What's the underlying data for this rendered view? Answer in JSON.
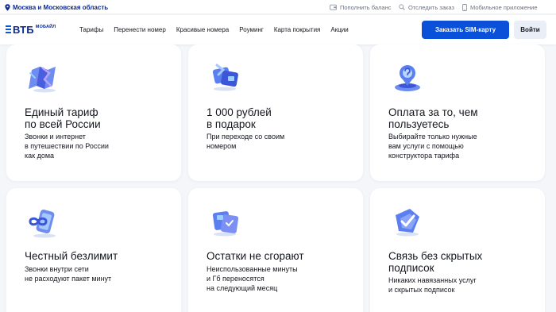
{
  "topbar": {
    "region": "Москва и Московская область",
    "links": [
      {
        "label": "Пополнить баланс",
        "icon": "wallet-icon"
      },
      {
        "label": "Отследить заказ",
        "icon": "search-icon"
      },
      {
        "label": "Мобильное приложение",
        "icon": "smartphone-icon"
      }
    ]
  },
  "header": {
    "logo": {
      "text": "ВТБ",
      "sub": "МОБАЙЛ"
    },
    "nav": [
      "Тарифы",
      "Перенести номер",
      "Красивые номера",
      "Роуминг",
      "Карта покрытия",
      "Акции"
    ],
    "order_button": "Заказать SIM-карту",
    "login_button": "Войти"
  },
  "colors": {
    "brand": "#0a2896",
    "accent": "#0a50d8",
    "page_bg": "#f4f6fa"
  },
  "cards": [
    {
      "icon": "road-map-icon",
      "title": [
        "Единый тариф",
        "по всей России"
      ],
      "text": [
        "Звонки и интернет",
        "в путешествии по России",
        "как дома"
      ]
    },
    {
      "icon": "gift-ribbon-icon",
      "title": [
        "1 000 рублей",
        "в подарок"
      ],
      "text": [
        "При переходе со своим",
        "номером"
      ]
    },
    {
      "icon": "location-pin-icon",
      "title": [
        "Оплата за то, чем",
        "пользуетесь"
      ],
      "text": [
        "Выбирайте только нужные",
        "вам услуги с помощью",
        "конструктора тарифа"
      ]
    },
    {
      "icon": "infinity-phone-icon",
      "title": [
        "Честный безлимит"
      ],
      "text": [
        "Звонки внутри сети",
        "не расходуют пакет минут"
      ]
    },
    {
      "icon": "transfer-cards-icon",
      "title": [
        "Остатки не сгорают"
      ],
      "text": [
        "Неиспользованные минуты",
        "и Гб переносятся",
        "на следующий месяц"
      ]
    },
    {
      "icon": "check-shield-icon",
      "title": [
        "Связь без скрытых",
        "подписок"
      ],
      "text": [
        "Никаких навязанных услуг",
        "и скрытых подписок"
      ]
    }
  ]
}
